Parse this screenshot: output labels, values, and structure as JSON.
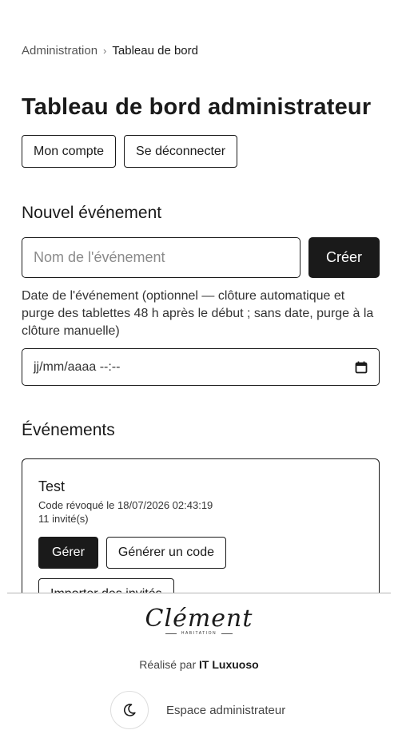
{
  "breadcrumb": {
    "root": "Administration",
    "separator": "›",
    "current": "Tableau de bord"
  },
  "page_title": "Tableau de bord administrateur",
  "account": {
    "my_account": "Mon compte",
    "logout": "Se déconnecter"
  },
  "new_event": {
    "heading": "Nouvel événement",
    "name_placeholder": "Nom de l'événement",
    "create_label": "Créer",
    "date_hint": "Date de l'événement (optionnel — clôture automatique et purge des tablettes 48 h après le début ; sans date, purge à la clôture manuelle)",
    "date_value": "jj/mm/aaaa --:--"
  },
  "events": {
    "heading": "Événements",
    "items": [
      {
        "title": "Test",
        "status": "Code révoqué le 18/07/2026 02:43:19",
        "guests": "11 invité(s)",
        "manage_label": "Gérer",
        "generate_label": "Générer un code",
        "import_label": "Importer des invités"
      }
    ]
  },
  "footer": {
    "logo_text": "Clément",
    "logo_subtitle": "HABITATION",
    "made_by_prefix": "Réalisé par",
    "made_by_name": "IT Luxuoso",
    "admin_link": "Espace administrateur"
  },
  "icons": {
    "theme_toggle": "moon-icon",
    "calendar": "calendar-icon"
  }
}
